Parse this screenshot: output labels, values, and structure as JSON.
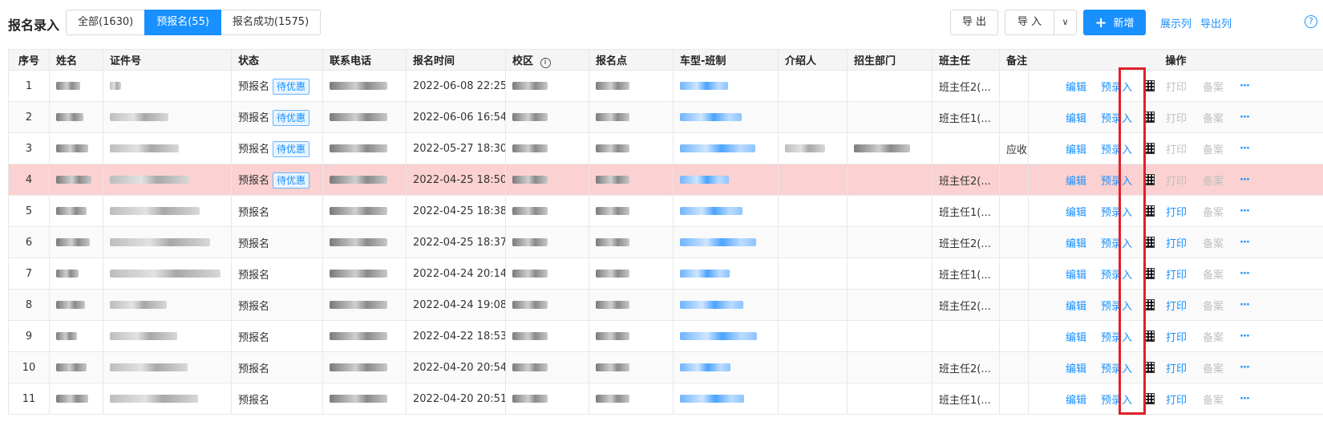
{
  "toolbar": {
    "title": "报名录入",
    "tabs": [
      {
        "label": "全部(1630)"
      },
      {
        "label": "预报名(55)"
      },
      {
        "label": "报名成功(1575)"
      }
    ],
    "export_label": "导 出",
    "import_label": "导 入",
    "import_arrow": "∨",
    "add_label": "新增",
    "add_icon": "+",
    "show_columns_label": "展示列",
    "export_columns_label": "导出列",
    "help_icon": "?"
  },
  "table": {
    "columns": [
      "序号",
      "姓名",
      "证件号",
      "状态",
      "联系电话",
      "报名时间",
      "校区",
      "报名点",
      "车型-班制",
      "介绍人",
      "招生部门",
      "班主任",
      "备注",
      "操作"
    ],
    "info_icon": "i",
    "status_prefix": "预报名",
    "tag_label": "待优惠",
    "actions": {
      "edit": "编辑",
      "pre_enter": "预录入",
      "print": "打印",
      "record": "备案",
      "more": "···"
    },
    "rows": [
      {
        "index": "1",
        "time": "2022-06-08 22:25",
        "tag": true,
        "teacher": "班主任2(...",
        "note": "",
        "print_enabled": false
      },
      {
        "index": "2",
        "time": "2022-06-06 16:54",
        "tag": true,
        "teacher": "班主任1(...",
        "note": "",
        "print_enabled": false
      },
      {
        "index": "3",
        "time": "2022-05-27 18:30",
        "tag": true,
        "teacher": "",
        "note": "应收",
        "print_enabled": false
      },
      {
        "index": "4",
        "time": "2022-04-25 18:50",
        "tag": true,
        "teacher": "班主任2(...",
        "note": "",
        "print_enabled": false
      },
      {
        "index": "5",
        "time": "2022-04-25 18:38",
        "tag": false,
        "teacher": "班主任1(...",
        "note": "",
        "print_enabled": true
      },
      {
        "index": "6",
        "time": "2022-04-25 18:37",
        "tag": false,
        "teacher": "班主任2(...",
        "note": "",
        "print_enabled": true
      },
      {
        "index": "7",
        "time": "2022-04-24 20:14",
        "tag": false,
        "teacher": "班主任1(...",
        "note": "",
        "print_enabled": true
      },
      {
        "index": "8",
        "time": "2022-04-24 19:08",
        "tag": false,
        "teacher": "班主任2(...",
        "note": "",
        "print_enabled": true
      },
      {
        "index": "9",
        "time": "2022-04-22 18:53",
        "tag": false,
        "teacher": "",
        "note": "",
        "print_enabled": true
      },
      {
        "index": "10",
        "time": "2022-04-20 20:54",
        "tag": false,
        "teacher": "班主任2(...",
        "note": "",
        "print_enabled": true
      },
      {
        "index": "11",
        "time": "2022-04-20 20:51",
        "tag": false,
        "teacher": "班主任1(...",
        "note": "",
        "print_enabled": true
      }
    ]
  },
  "colors": {
    "accent": "#1890ff",
    "highlight_row": "#fbd1d1",
    "annotation_box": "#e0202a"
  }
}
